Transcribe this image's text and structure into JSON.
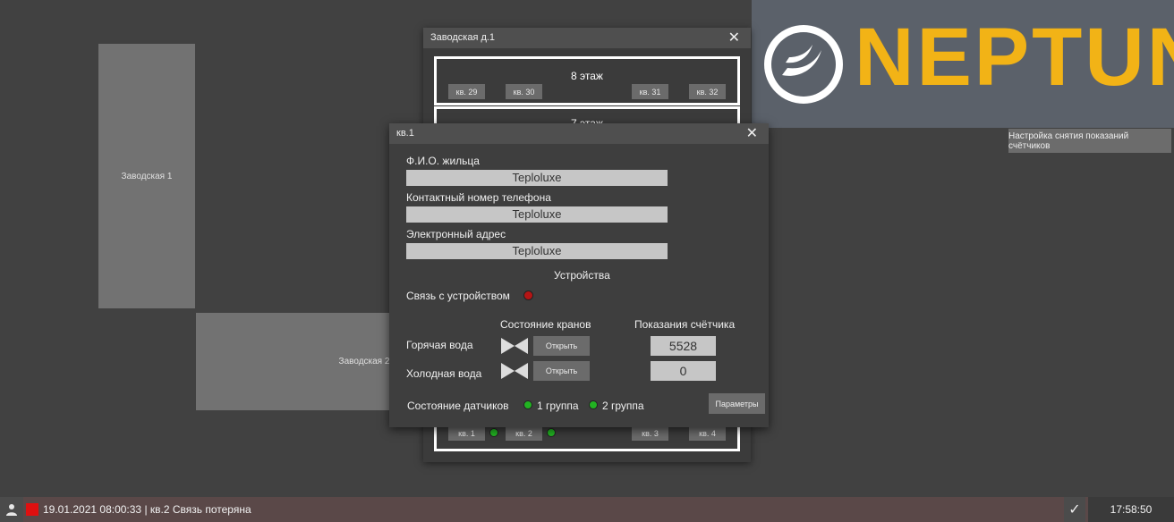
{
  "buildings": {
    "b1": "Заводская 1",
    "b2": "Заводская 2"
  },
  "logo": {
    "text": "NEPTUN",
    "color": "#f2b316"
  },
  "settings_button": "Настройка снятия показаний счётчиков",
  "building_window": {
    "title": "Заводская д.1",
    "floors": [
      {
        "label": "8 этаж",
        "apts": [
          "кв. 29",
          "кв. 30",
          "кв. 31",
          "кв. 32"
        ]
      },
      {
        "label": "7 этаж"
      },
      {
        "label": "",
        "apts": [
          "кв. 1",
          "кв. 2",
          "кв. 3",
          "кв. 4"
        ]
      }
    ]
  },
  "apartment_window": {
    "title": "кв.1",
    "fio_label": "Ф.И.О. жильца",
    "fio_value": "Teploluxe",
    "phone_label": "Контактный номер телефона",
    "phone_value": "Teploluxe",
    "email_label": "Электронный адрес",
    "email_value": "Teploluxe",
    "devices_heading": "Устройства",
    "device_link_label": "Связь с устройством",
    "valves_heading": "Состояние кранов",
    "meter_heading": "Показания счётчика",
    "hot_label": "Горячая вода",
    "cold_label": "Холодная вода",
    "open_label": "Открыть",
    "hot_value": "5528",
    "cold_value": "0",
    "sensors_label": "Состояние датчиков",
    "group1": "1 группа",
    "group2": "2 группа",
    "params_button": "Параметры"
  },
  "status_bar": {
    "message": "19.01.2021 08:00:33 | кв.2 Связь потеряна",
    "time": "17:58:50"
  }
}
